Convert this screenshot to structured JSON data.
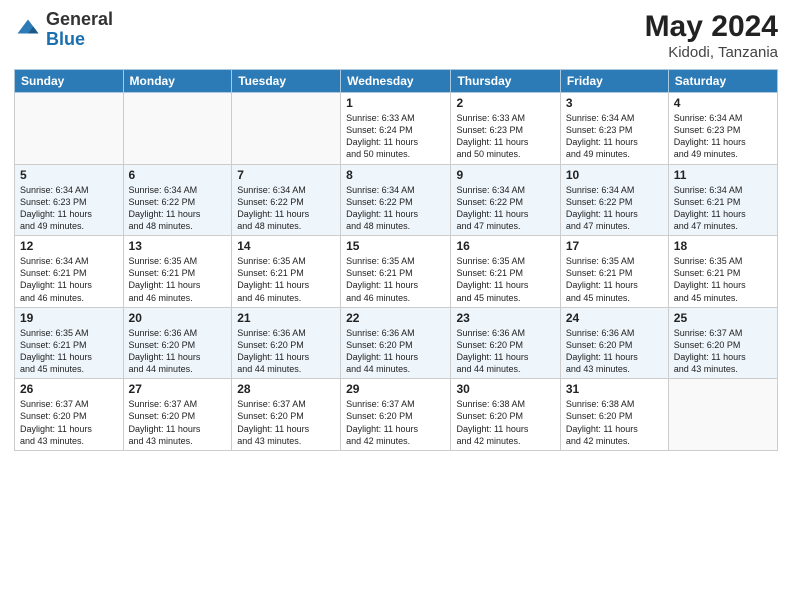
{
  "header": {
    "logo_general": "General",
    "logo_blue": "Blue",
    "month_title": "May 2024",
    "location": "Kidodi, Tanzania"
  },
  "weekdays": [
    "Sunday",
    "Monday",
    "Tuesday",
    "Wednesday",
    "Thursday",
    "Friday",
    "Saturday"
  ],
  "weeks": [
    [
      {
        "day": "",
        "info": ""
      },
      {
        "day": "",
        "info": ""
      },
      {
        "day": "",
        "info": ""
      },
      {
        "day": "1",
        "info": "Sunrise: 6:33 AM\nSunset: 6:24 PM\nDaylight: 11 hours\nand 50 minutes."
      },
      {
        "day": "2",
        "info": "Sunrise: 6:33 AM\nSunset: 6:23 PM\nDaylight: 11 hours\nand 50 minutes."
      },
      {
        "day": "3",
        "info": "Sunrise: 6:34 AM\nSunset: 6:23 PM\nDaylight: 11 hours\nand 49 minutes."
      },
      {
        "day": "4",
        "info": "Sunrise: 6:34 AM\nSunset: 6:23 PM\nDaylight: 11 hours\nand 49 minutes."
      }
    ],
    [
      {
        "day": "5",
        "info": "Sunrise: 6:34 AM\nSunset: 6:23 PM\nDaylight: 11 hours\nand 49 minutes."
      },
      {
        "day": "6",
        "info": "Sunrise: 6:34 AM\nSunset: 6:22 PM\nDaylight: 11 hours\nand 48 minutes."
      },
      {
        "day": "7",
        "info": "Sunrise: 6:34 AM\nSunset: 6:22 PM\nDaylight: 11 hours\nand 48 minutes."
      },
      {
        "day": "8",
        "info": "Sunrise: 6:34 AM\nSunset: 6:22 PM\nDaylight: 11 hours\nand 48 minutes."
      },
      {
        "day": "9",
        "info": "Sunrise: 6:34 AM\nSunset: 6:22 PM\nDaylight: 11 hours\nand 47 minutes."
      },
      {
        "day": "10",
        "info": "Sunrise: 6:34 AM\nSunset: 6:22 PM\nDaylight: 11 hours\nand 47 minutes."
      },
      {
        "day": "11",
        "info": "Sunrise: 6:34 AM\nSunset: 6:21 PM\nDaylight: 11 hours\nand 47 minutes."
      }
    ],
    [
      {
        "day": "12",
        "info": "Sunrise: 6:34 AM\nSunset: 6:21 PM\nDaylight: 11 hours\nand 46 minutes."
      },
      {
        "day": "13",
        "info": "Sunrise: 6:35 AM\nSunset: 6:21 PM\nDaylight: 11 hours\nand 46 minutes."
      },
      {
        "day": "14",
        "info": "Sunrise: 6:35 AM\nSunset: 6:21 PM\nDaylight: 11 hours\nand 46 minutes."
      },
      {
        "day": "15",
        "info": "Sunrise: 6:35 AM\nSunset: 6:21 PM\nDaylight: 11 hours\nand 46 minutes."
      },
      {
        "day": "16",
        "info": "Sunrise: 6:35 AM\nSunset: 6:21 PM\nDaylight: 11 hours\nand 45 minutes."
      },
      {
        "day": "17",
        "info": "Sunrise: 6:35 AM\nSunset: 6:21 PM\nDaylight: 11 hours\nand 45 minutes."
      },
      {
        "day": "18",
        "info": "Sunrise: 6:35 AM\nSunset: 6:21 PM\nDaylight: 11 hours\nand 45 minutes."
      }
    ],
    [
      {
        "day": "19",
        "info": "Sunrise: 6:35 AM\nSunset: 6:21 PM\nDaylight: 11 hours\nand 45 minutes."
      },
      {
        "day": "20",
        "info": "Sunrise: 6:36 AM\nSunset: 6:20 PM\nDaylight: 11 hours\nand 44 minutes."
      },
      {
        "day": "21",
        "info": "Sunrise: 6:36 AM\nSunset: 6:20 PM\nDaylight: 11 hours\nand 44 minutes."
      },
      {
        "day": "22",
        "info": "Sunrise: 6:36 AM\nSunset: 6:20 PM\nDaylight: 11 hours\nand 44 minutes."
      },
      {
        "day": "23",
        "info": "Sunrise: 6:36 AM\nSunset: 6:20 PM\nDaylight: 11 hours\nand 44 minutes."
      },
      {
        "day": "24",
        "info": "Sunrise: 6:36 AM\nSunset: 6:20 PM\nDaylight: 11 hours\nand 43 minutes."
      },
      {
        "day": "25",
        "info": "Sunrise: 6:37 AM\nSunset: 6:20 PM\nDaylight: 11 hours\nand 43 minutes."
      }
    ],
    [
      {
        "day": "26",
        "info": "Sunrise: 6:37 AM\nSunset: 6:20 PM\nDaylight: 11 hours\nand 43 minutes."
      },
      {
        "day": "27",
        "info": "Sunrise: 6:37 AM\nSunset: 6:20 PM\nDaylight: 11 hours\nand 43 minutes."
      },
      {
        "day": "28",
        "info": "Sunrise: 6:37 AM\nSunset: 6:20 PM\nDaylight: 11 hours\nand 43 minutes."
      },
      {
        "day": "29",
        "info": "Sunrise: 6:37 AM\nSunset: 6:20 PM\nDaylight: 11 hours\nand 42 minutes."
      },
      {
        "day": "30",
        "info": "Sunrise: 6:38 AM\nSunset: 6:20 PM\nDaylight: 11 hours\nand 42 minutes."
      },
      {
        "day": "31",
        "info": "Sunrise: 6:38 AM\nSunset: 6:20 PM\nDaylight: 11 hours\nand 42 minutes."
      },
      {
        "day": "",
        "info": ""
      }
    ]
  ]
}
